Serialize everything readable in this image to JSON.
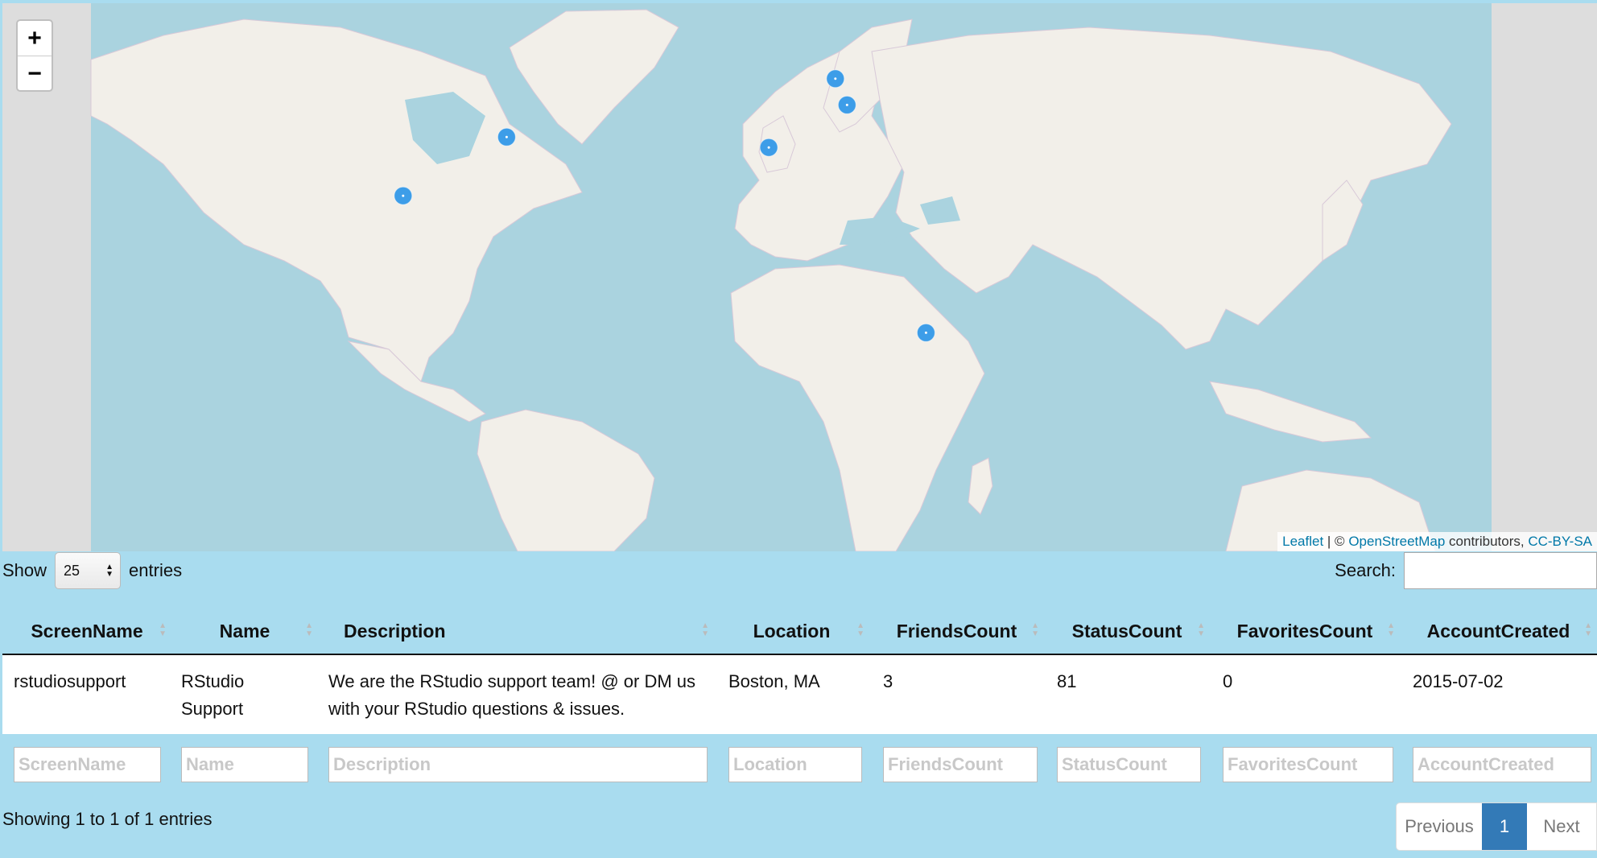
{
  "map": {
    "zoom_in": "+",
    "zoom_out": "−",
    "attribution": {
      "leaflet": "Leaflet",
      "sep": " | © ",
      "osm": "OpenStreetMap",
      "contrib": " contributors, ",
      "license": "CC-BY-SA"
    },
    "colors": {
      "water": "#aad3df",
      "land": "#f2efe9",
      "border": "#c9a0c9",
      "marker": "#3d9de8",
      "outside": "#dddddd"
    },
    "markers": [
      {
        "lat": 30.3,
        "lon": -97.7
      },
      {
        "lat": 42.4,
        "lon": -71.1
      },
      {
        "lat": 40.4,
        "lon": -3.7
      },
      {
        "lat": 52.5,
        "lon": 13.4
      },
      {
        "lat": 48.2,
        "lon": 16.4
      },
      {
        "lat": -3.4,
        "lon": 36.7
      }
    ]
  },
  "controls": {
    "show_label": "Show",
    "length_value": "25",
    "entries_label": "entries",
    "search_label": "Search:",
    "search_value": ""
  },
  "table": {
    "columns": [
      "ScreenName",
      "Name",
      "Description",
      "Location",
      "FriendsCount",
      "StatusCount",
      "FavoritesCount",
      "AccountCreated"
    ],
    "rows": [
      {
        "ScreenName": "rstudiosupport",
        "Name": "RStudio Support",
        "Description": "We are the RStudio support team! @ or DM us with your RStudio questions & issues.",
        "Location": "Boston, MA",
        "FriendsCount": "3",
        "StatusCount": "81",
        "FavoritesCount": "0",
        "AccountCreated": "2015-07-02"
      }
    ],
    "filter_placeholders": [
      "ScreenName",
      "Name",
      "Description",
      "Location",
      "FriendsCount",
      "StatusCount",
      "FavoritesCount",
      "AccountCreated"
    ]
  },
  "footer": {
    "info": "Showing 1 to 1 of 1 entries",
    "previous": "Previous",
    "current_page": "1",
    "next": "Next"
  }
}
